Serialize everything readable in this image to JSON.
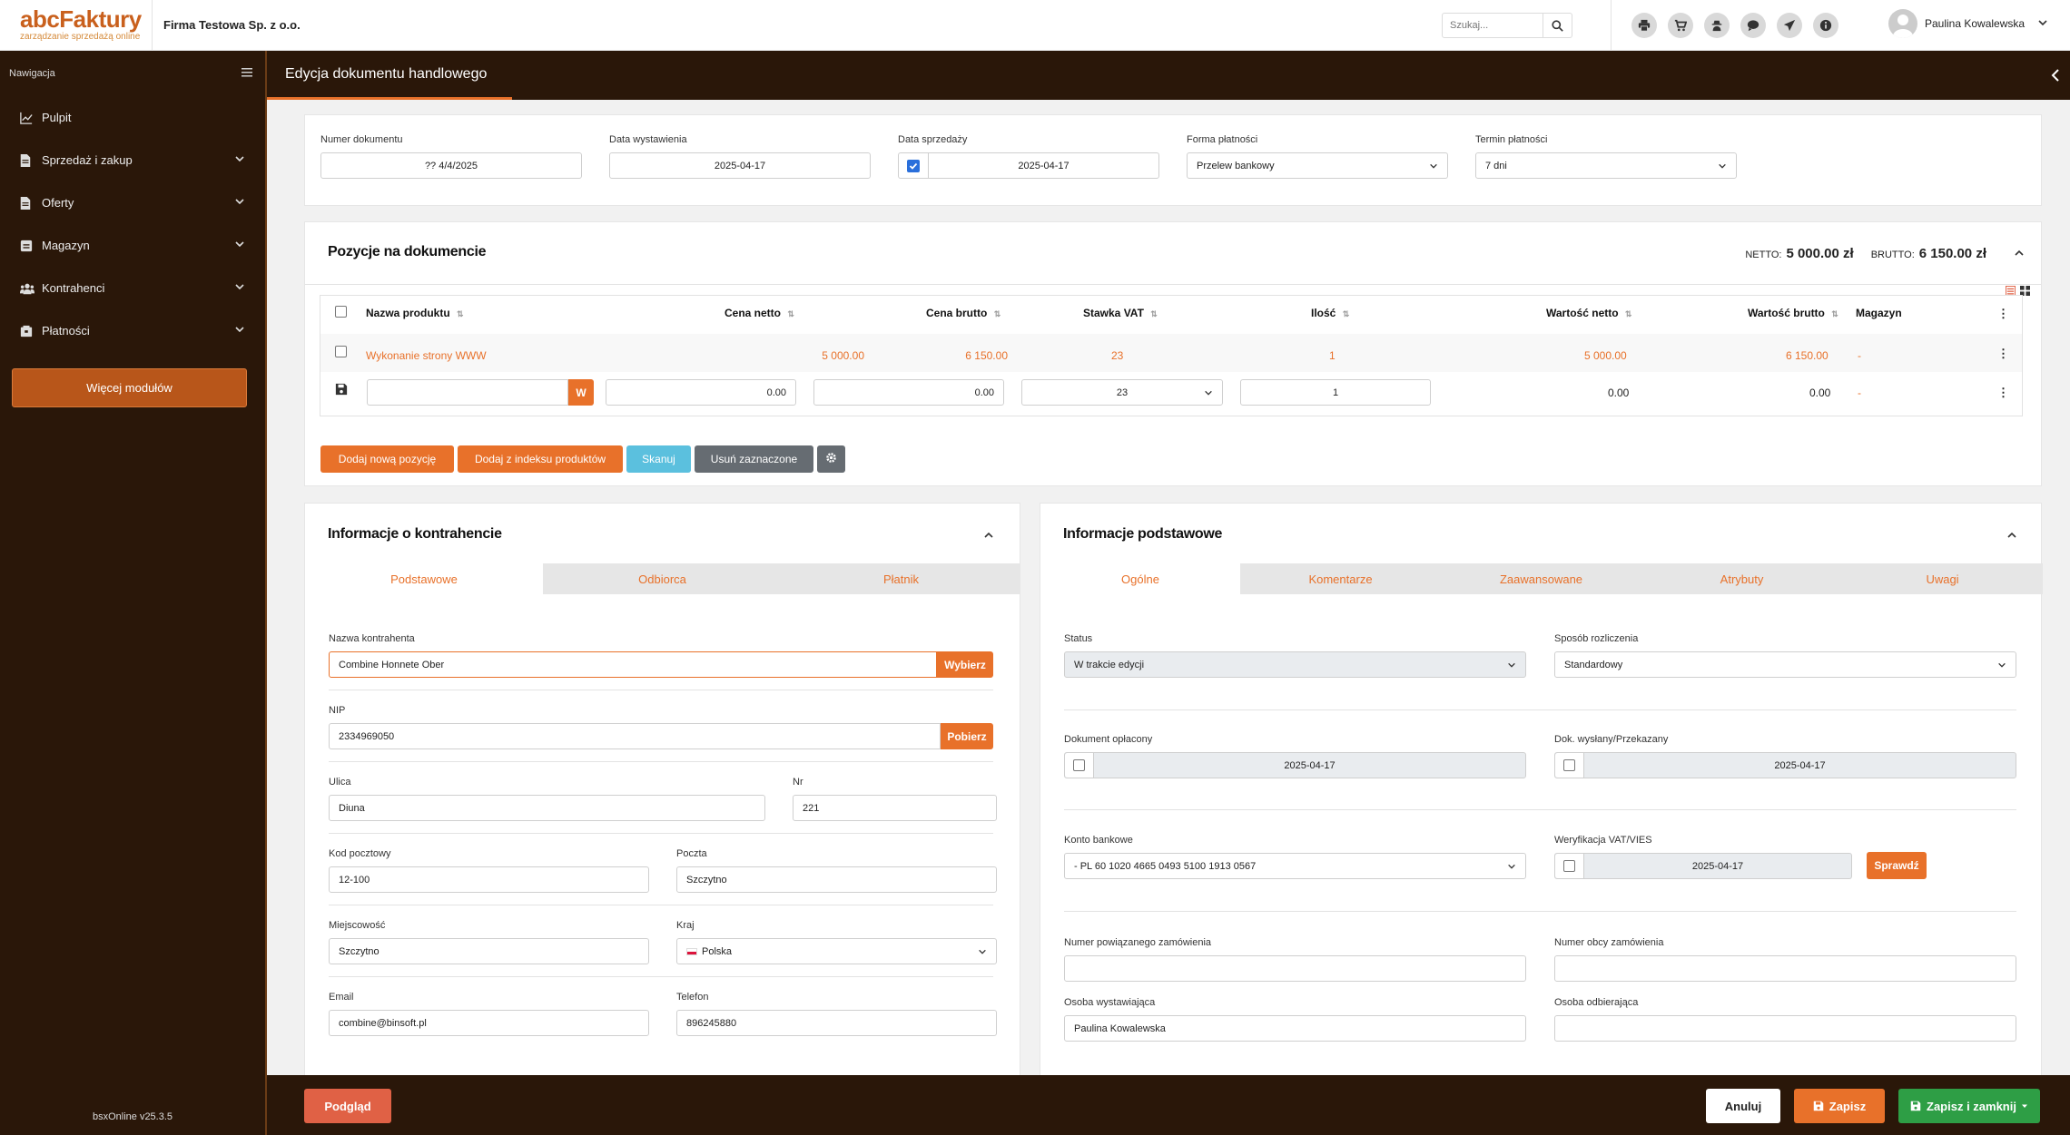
{
  "brand": {
    "name": "abcFaktury",
    "tagline": "zarządzanie sprzedażą online"
  },
  "company": "Firma Testowa Sp. z o.o.",
  "search": {
    "placeholder": "Szukaj..."
  },
  "top_icons": [
    "printer-icon",
    "cart-icon",
    "user-secret-icon",
    "chat-icon",
    "send-icon",
    "info-icon"
  ],
  "user": {
    "name": "Paulina Kowalewska"
  },
  "sidebar": {
    "heading": "Nawigacja",
    "items": [
      {
        "label": "Pulpit",
        "icon": "chart-line-icon",
        "has_children": false
      },
      {
        "label": "Sprzedaż i zakup",
        "icon": "file-icon",
        "has_children": true
      },
      {
        "label": "Oferty",
        "icon": "file-icon",
        "has_children": true
      },
      {
        "label": "Magazyn",
        "icon": "warehouse-icon",
        "has_children": true
      },
      {
        "label": "Kontrahenci",
        "icon": "users-icon",
        "has_children": true
      },
      {
        "label": "Płatności",
        "icon": "wallet-icon",
        "has_children": true
      }
    ],
    "more_modules": "Więcej modułów",
    "version": "bsxOnline v25.3.5"
  },
  "page": {
    "title": "Edycja dokumentu handlowego"
  },
  "doc": {
    "number": {
      "label": "Numer dokumentu",
      "value": "?? 4/4/2025"
    },
    "issue_date": {
      "label": "Data wystawienia",
      "value": "2025-04-17"
    },
    "sale_date": {
      "label": "Data sprzedaży",
      "value": "2025-04-17",
      "checked": true
    },
    "payment_form": {
      "label": "Forma płatności",
      "value": "Przelew bankowy"
    },
    "payment_term": {
      "label": "Termin płatności",
      "value": "7 dni"
    }
  },
  "positions": {
    "title": "Pozycje na dokumencie",
    "netto_label": "NETTO:",
    "netto_value": "5 000.00 zł",
    "brutto_label": "BRUTTO:",
    "brutto_value": "6 150.00 zł",
    "columns": [
      "Nazwa produktu",
      "Cena netto",
      "Cena brutto",
      "Stawka VAT",
      "Ilość",
      "Wartość netto",
      "Wartość brutto",
      "Magazyn"
    ],
    "row": {
      "name": "Wykonanie strony WWW",
      "netto": "5 000.00",
      "brutto": "6 150.00",
      "vat": "23",
      "qty": "1",
      "value_netto": "5 000.00",
      "value_brutto": "6 150.00",
      "warehouse": "-"
    },
    "new_row": {
      "w_button": "W",
      "netto": "0.00",
      "brutto": "0.00",
      "vat": "23",
      "qty": "1",
      "value_netto": "0.00",
      "value_brutto": "0.00",
      "warehouse": "-"
    },
    "buttons": {
      "add_new": "Dodaj nową pozycję",
      "add_index": "Dodaj z indeksu produktów",
      "scan": "Skanuj",
      "delete": "Usuń zaznaczone"
    }
  },
  "contractor": {
    "title": "Informacje o kontrahencie",
    "tabs": [
      "Podstawowe",
      "Odbiorca",
      "Płatnik"
    ],
    "name": {
      "label": "Nazwa kontrahenta",
      "value": "Combine Honnete Ober",
      "button": "Wybierz"
    },
    "nip": {
      "label": "NIP",
      "value": "2334969050",
      "button": "Pobierz"
    },
    "street": {
      "label": "Ulica",
      "value": "Diuna"
    },
    "nr": {
      "label": "Nr",
      "value": "221"
    },
    "postal": {
      "label": "Kod pocztowy",
      "value": "12-100"
    },
    "post": {
      "label": "Poczta",
      "value": "Szczytno"
    },
    "city": {
      "label": "Miejscowość",
      "value": "Szczytno"
    },
    "country": {
      "label": "Kraj",
      "value": "Polska"
    },
    "email": {
      "label": "Email",
      "value": "combine@binsoft.pl"
    },
    "phone": {
      "label": "Telefon",
      "value": "896245880"
    }
  },
  "basic": {
    "title": "Informacje podstawowe",
    "tabs": [
      "Ogólne",
      "Komentarze",
      "Zaawansowane",
      "Atrybuty",
      "Uwagi"
    ],
    "status": {
      "label": "Status",
      "value": "W trakcie edycji"
    },
    "settlement": {
      "label": "Sposób rozliczenia",
      "value": "Standardowy"
    },
    "paid": {
      "label": "Dokument opłacony",
      "value": "2025-04-17"
    },
    "sent": {
      "label": "Dok. wysłany/Przekazany",
      "value": "2025-04-17"
    },
    "bank": {
      "label": "Konto bankowe",
      "value": "- PL 60 1020 4665 0493 5100 1913 0567"
    },
    "vat_check": {
      "label": "Weryfikacja VAT/VIES",
      "value": "2025-04-17",
      "button": "Sprawdź"
    },
    "related_order": {
      "label": "Numer powiązanego zamówienia",
      "value": ""
    },
    "foreign_order": {
      "label": "Numer obcy zamówienia",
      "value": ""
    },
    "issuer": {
      "label": "Osoba wystawiająca",
      "value": "Paulina Kowalewska"
    },
    "receiver": {
      "label": "Osoba odbierająca",
      "value": ""
    }
  },
  "footer": {
    "preview": "Podgląd",
    "cancel": "Anuluj",
    "save": "Zapisz",
    "save_close": "Zapisz i zamknij"
  },
  "colors": {
    "accent": "#e8712a",
    "dark": "#2a1709",
    "info": "#5bc0de",
    "secondary": "#666c72",
    "success": "#2e9e45",
    "danger": "#e06145"
  }
}
